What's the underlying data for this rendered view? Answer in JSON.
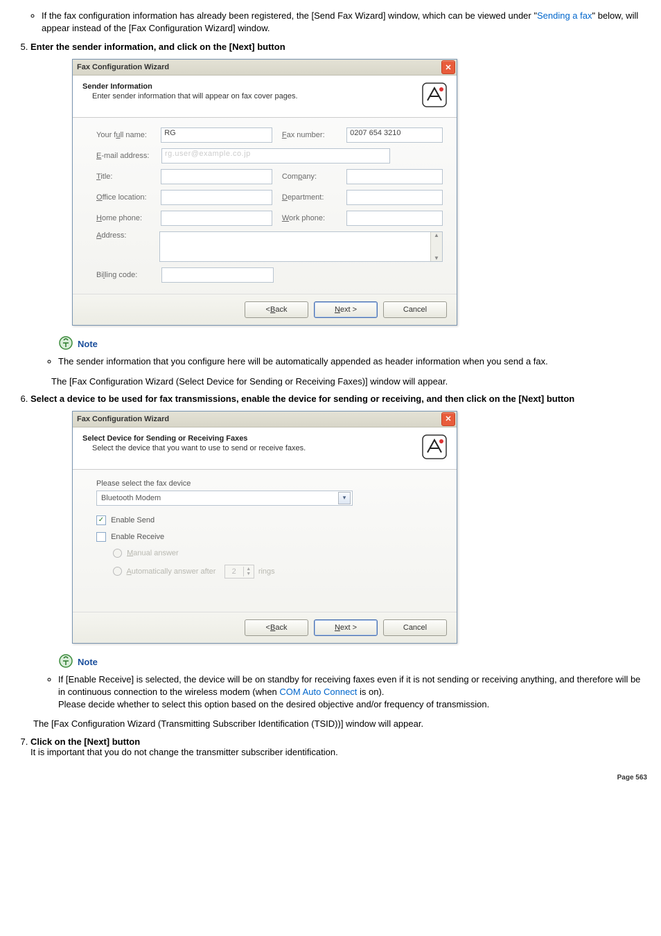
{
  "intro": {
    "bullet_prefix": "If the fax configuration information has already been registered, the [Send Fax Wizard] window, which can be viewed under \"",
    "link": "Sending a fax",
    "bullet_suffix": "\" below, will appear instead of the [Fax Configuration Wizard] window."
  },
  "step5": {
    "heading": "Enter the sender information, and click on the [Next] button",
    "dialog": {
      "title": "Fax Configuration Wizard",
      "head_title": "Sender Information",
      "head_sub": "Enter sender information that will appear on fax cover pages.",
      "labels": {
        "fullname": "Your full name:",
        "fullname_u": "u",
        "faxnumber": "Fax number:",
        "faxnumber_u": "F",
        "email": "E-mail address:",
        "email_u": "E",
        "title": "Title:",
        "title_u": "T",
        "company": "Company:",
        "company_u": "p",
        "office": "Office location:",
        "office_u": "O",
        "department": "Department:",
        "department_u": "D",
        "home": "Home phone:",
        "home_u": "H",
        "work": "Work phone:",
        "work_u": "W",
        "address": "Address:",
        "address_u": "A",
        "billing": "Billing code:",
        "billing_u": "l"
      },
      "values": {
        "fullname": "RG",
        "faxnumber": "0207 654 3210",
        "email": "rg.user@example.co.jp"
      },
      "buttons": {
        "back": "< Back",
        "next": "Next >",
        "cancel": "Cancel",
        "back_u": "B",
        "next_u": "N"
      }
    },
    "note_label": "Note",
    "note_bullet": "The sender information that you configure here will be automatically appended as header information when you send a fax.",
    "after": "The [Fax Configuration Wizard (Select Device for Sending or Receiving Faxes)] window will appear."
  },
  "step6": {
    "heading": "Select a device to be used for fax transmissions, enable the device for sending or receiving, and then click on the [Next] button",
    "dialog": {
      "title": "Fax Configuration Wizard",
      "head_title": "Select Device for Sending or Receiving Faxes",
      "head_sub": "Select the device that you want to use to send or receive faxes.",
      "select_label": "Please select the fax device",
      "select_label_u": "s",
      "select_value": "Bluetooth Modem",
      "enable_send": "Enable Send",
      "enable_send_u": "E",
      "enable_receive": "Enable Receive",
      "enable_receive_u": "R",
      "manual": "Manual answer",
      "manual_u": "M",
      "auto": "Automatically answer after",
      "auto_u": "A",
      "rings_num": "2",
      "rings": "rings",
      "buttons": {
        "back": "< Back",
        "next": "Next >",
        "cancel": "Cancel",
        "back_u": "B",
        "next_u": "N"
      }
    },
    "note_label": "Note",
    "note_bullet_prefix": "If [Enable Receive] is selected, the device will be on standby for receiving faxes even if it is not sending or receiving anything, and therefore will be in continuous connection to the wireless modem (when ",
    "note_link": "COM Auto Connect",
    "note_bullet_suffix": " is on).",
    "note_bullet_line2": "Please decide whether to select this option based on the desired objective and/or frequency of transmission.",
    "after": "The [Fax Configuration Wizard (Transmitting Subscriber Identification (TSID))] window will appear."
  },
  "step7": {
    "heading": "Click on the [Next] button",
    "line": "It is important that you do not change the transmitter subscriber identification."
  },
  "footer": "Page  563"
}
